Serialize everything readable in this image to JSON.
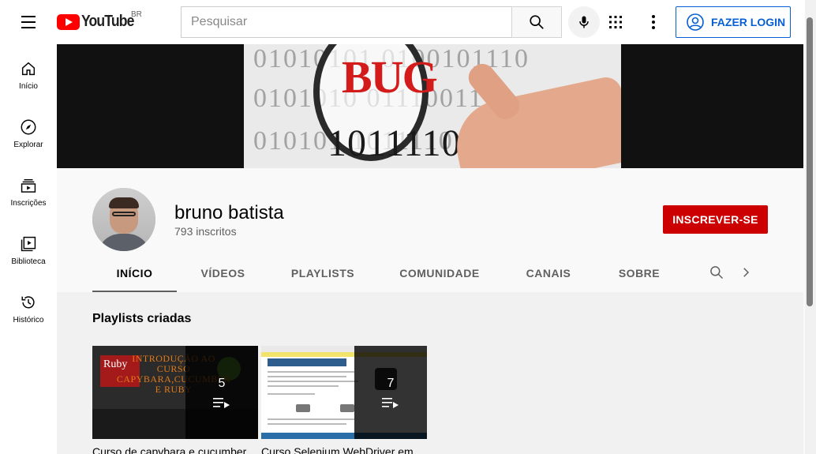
{
  "header": {
    "logo_text": "YouTube",
    "country_code": "BR",
    "search_placeholder": "Pesquisar",
    "login_label": "FAZER LOGIN"
  },
  "sidebar": {
    "items": [
      {
        "label": "Início",
        "icon": "home-icon"
      },
      {
        "label": "Explorar",
        "icon": "compass-icon"
      },
      {
        "label": "Inscrições",
        "icon": "subscriptions-icon"
      },
      {
        "label": "Biblioteca",
        "icon": "library-icon"
      },
      {
        "label": "Histórico",
        "icon": "history-icon"
      }
    ]
  },
  "banner": {
    "bug_text": "BUG",
    "binary_top": "01010101 0100101110",
    "binary_mid": "0101010 011100111",
    "binary_low": "010101 1011110 010",
    "binary_dark": "1011110"
  },
  "channel": {
    "name": "bruno batista",
    "subscribers": "793 inscritos",
    "subscribe_label": "INSCREVER-SE"
  },
  "tabs": [
    {
      "label": "INÍCIO",
      "active": true
    },
    {
      "label": "VÍDEOS",
      "active": false
    },
    {
      "label": "PLAYLISTS",
      "active": false
    },
    {
      "label": "COMUNIDADE",
      "active": false
    },
    {
      "label": "CANAIS",
      "active": false
    },
    {
      "label": "SOBRE",
      "active": false
    }
  ],
  "content": {
    "section_title": "Playlists criadas",
    "playlists": [
      {
        "title": "Curso de capybara e cucumber",
        "count": "5",
        "thumb_ruby": "Ruby",
        "thumb_text": "INTRODUÇÃO AO CURSO CAPYBARA,CUCUMBER E RUBY"
      },
      {
        "title": "Curso Selenium WebDriver em",
        "count": "7"
      }
    ]
  },
  "colors": {
    "brand_red": "#ff0000",
    "subscribe_red": "#cc0000",
    "link_blue": "#065fd4"
  }
}
